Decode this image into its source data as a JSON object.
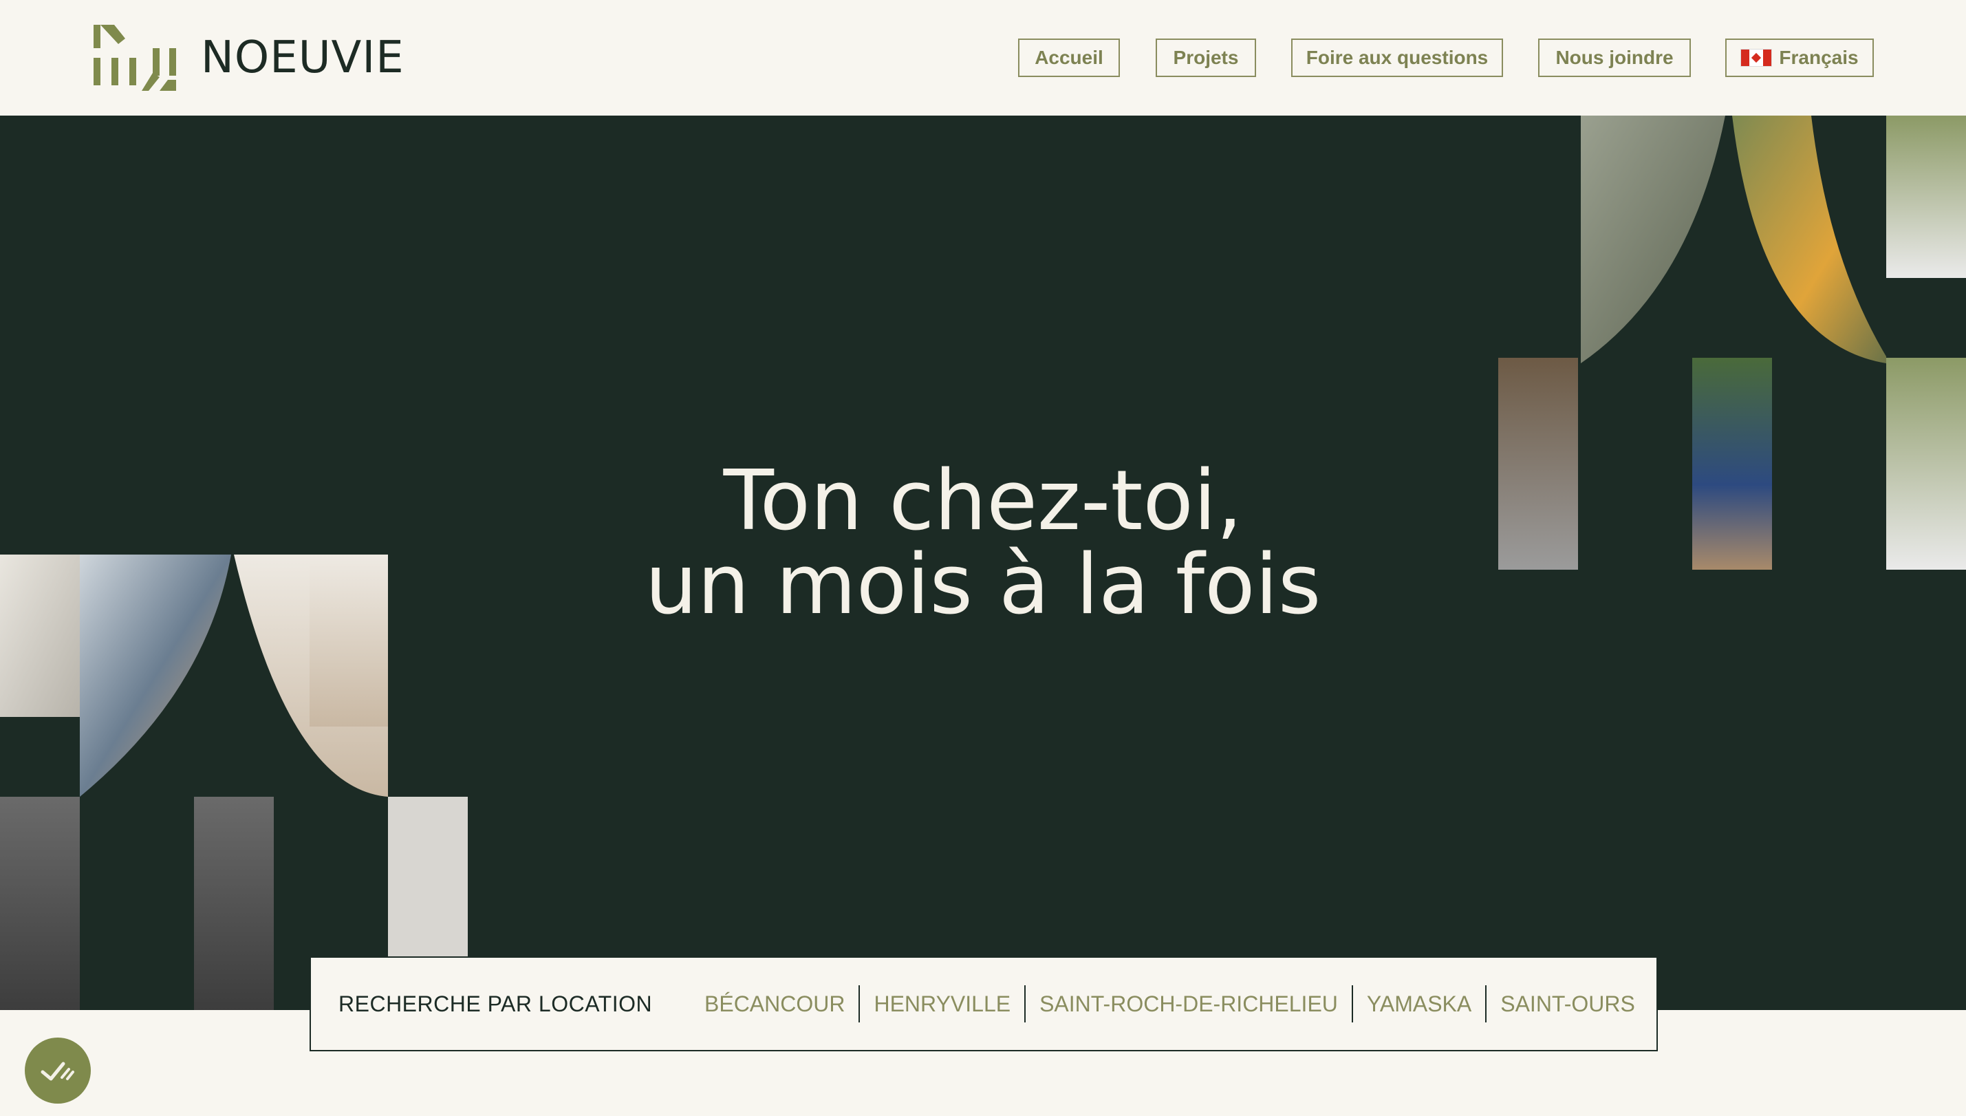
{
  "brand": {
    "name": "NOEUVIE"
  },
  "nav": {
    "items": [
      {
        "label": "Accueil"
      },
      {
        "label": "Projets"
      },
      {
        "label": "Foire aux questions"
      },
      {
        "label": "Nous joindre"
      }
    ],
    "language": {
      "label": "Français",
      "flag": "canada-flag-icon"
    }
  },
  "hero": {
    "line1": "Ton chez-toi,",
    "line2": "un mois à la fois"
  },
  "search": {
    "label": "RECHERCHE PAR LOCATION",
    "locations": [
      "BÉCANCOUR",
      "HENRYVILLE",
      "SAINT-ROCH-DE-RICHELIEU",
      "YAMASKA",
      "SAINT-OURS"
    ]
  },
  "colors": {
    "dark_green": "#1c2b25",
    "olive": "#7d8252",
    "cream": "#f8f6f0"
  }
}
